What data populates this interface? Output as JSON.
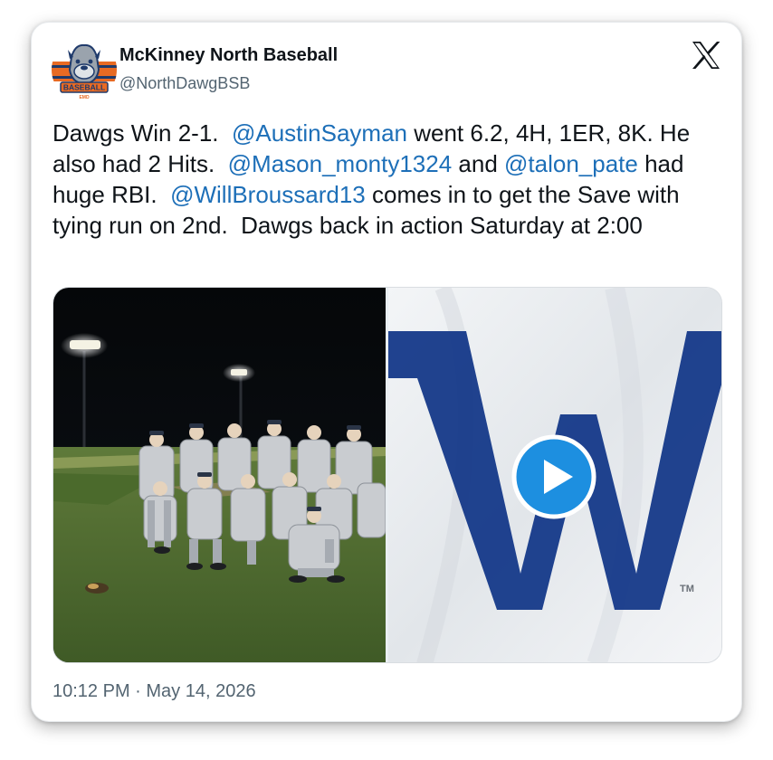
{
  "author": {
    "display_name": "McKinney North Baseball",
    "handle": "@NorthDawgBSB",
    "avatar_text": "BASEBALL",
    "avatar_subtext": "EMD"
  },
  "tweet": {
    "segments": [
      {
        "text": "Dawgs Win 2-1.  ",
        "mention": false
      },
      {
        "text": "@AustinSayman",
        "mention": true
      },
      {
        "text": " went 6.2, 4H, 1ER, 8K. He also had 2 Hits.  ",
        "mention": false
      },
      {
        "text": "@Mason_monty1324",
        "mention": true
      },
      {
        "text": " and ",
        "mention": false
      },
      {
        "text": "@talon_pate",
        "mention": true
      },
      {
        "text": " had huge RBI.  ",
        "mention": false
      },
      {
        "text": "@WillBroussard13",
        "mention": true
      },
      {
        "text": " comes in to get the Save with tying run on 2nd.  Dawgs back in action Saturday at 2:00",
        "mention": false
      }
    ]
  },
  "media": {
    "right_letter": "W",
    "right_mark": "TM"
  },
  "timestamp": "10:12 PM · May 14, 2026",
  "colors": {
    "mention": "#1d6fb8",
    "text": "#0f1419",
    "secondary": "#536471",
    "cubs_blue": "#0e3386",
    "play_blue": "#1d8fe0"
  },
  "icons": {
    "brand": "x-logo-icon",
    "video": "play-icon"
  }
}
